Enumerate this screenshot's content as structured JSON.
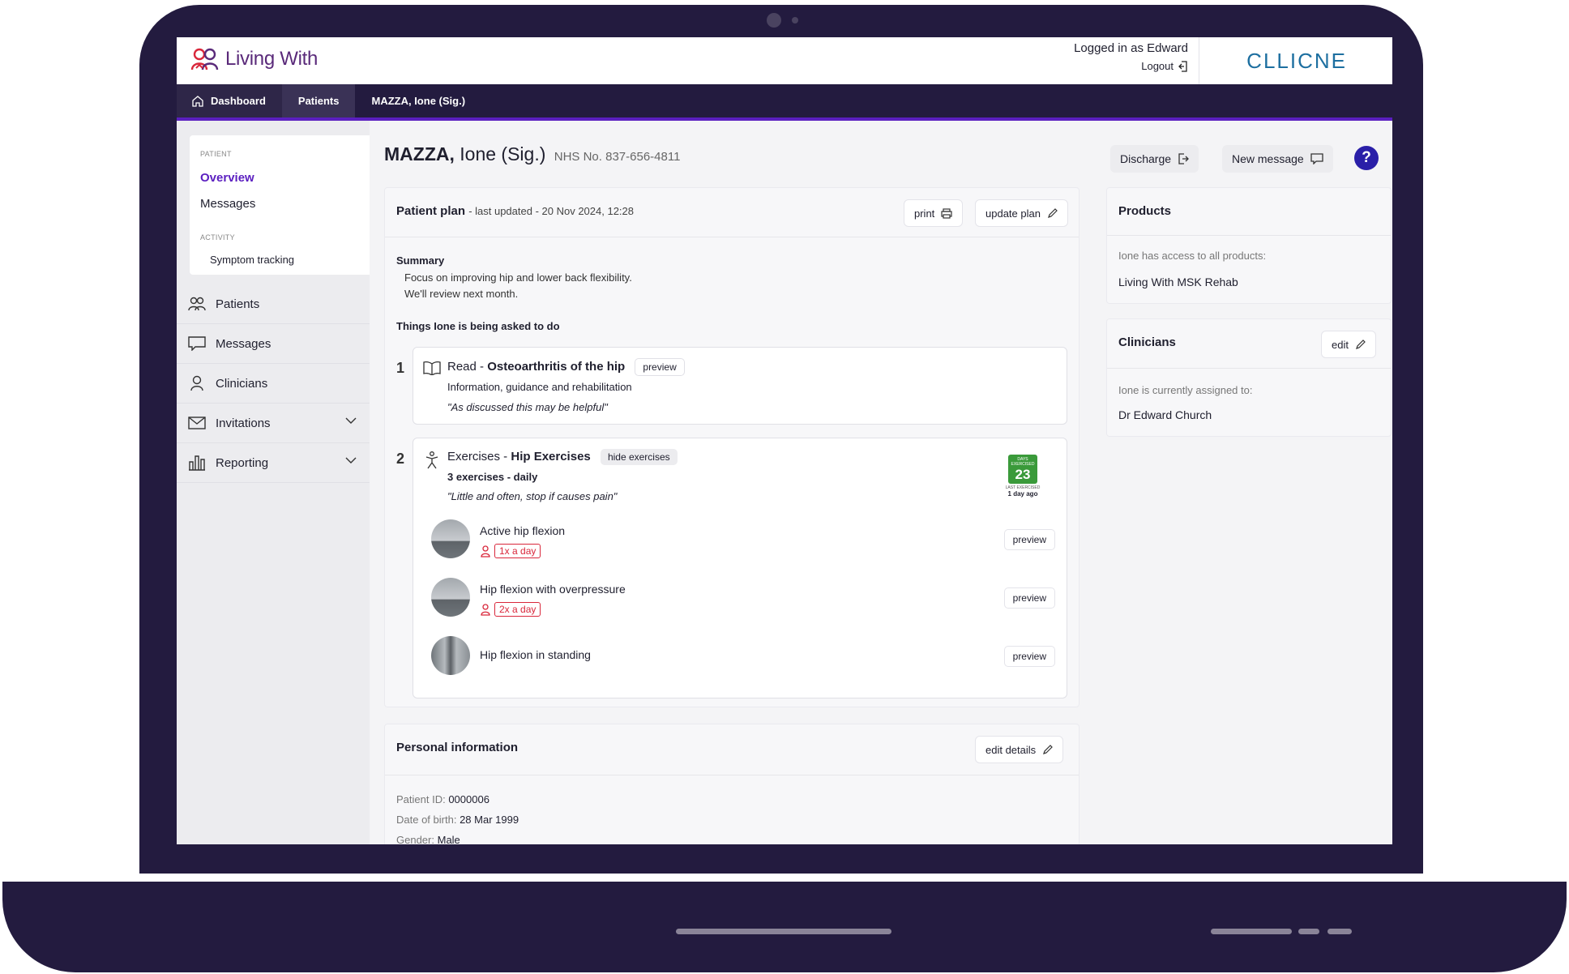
{
  "app": {
    "logo_text": "Living With",
    "brand": "CLLICNE"
  },
  "header": {
    "logged_in": "Logged in as Edward",
    "logout": "Logout"
  },
  "breadcrumb": {
    "home": "Dashboard",
    "patients": "Patients",
    "current": "MAZZA, Ione (Sig.)"
  },
  "sidebar": {
    "patient_label": "PATIENT",
    "overview": "Overview",
    "messages": "Messages",
    "activity_label": "ACTIVITY",
    "symptom_tracking": "Symptom tracking",
    "nav": [
      {
        "label": "Patients"
      },
      {
        "label": "Messages"
      },
      {
        "label": "Clinicians"
      },
      {
        "label": "Invitations"
      },
      {
        "label": "Reporting"
      }
    ]
  },
  "patient": {
    "surname": "MAZZA,",
    "given": "Ione (Sig.)",
    "nhs": "NHS No. 837-656-4811"
  },
  "actions": {
    "discharge": "Discharge",
    "new_message": "New message",
    "help": "?"
  },
  "plan": {
    "title": "Patient plan",
    "updated": "- last updated - 20 Nov 2024, 12:28",
    "print": "print",
    "update": "update plan",
    "summary_title": "Summary",
    "summary_line1": "Focus on improving hip and lower back flexibility.",
    "summary_line2": "We'll review next month.",
    "tasks_title": "Things Ione is being asked to do",
    "task1": {
      "num": "1",
      "prefix": "Read - ",
      "name": "Osteoarthritis of the hip",
      "tag": "preview",
      "desc": "Information, guidance and rehabilitation",
      "note": "\"As discussed this may be helpful\""
    },
    "task2": {
      "num": "2",
      "prefix": "Exercises - ",
      "name": "Hip Exercises",
      "tag": "hide exercises",
      "freq": "3 exercises - daily",
      "note": "\"Little and often, stop if causes pain\"",
      "calendar_top": "DAYS EXERCISED",
      "calendar_day": "23",
      "calendar_bottom": "LAST EXERCISED",
      "calendar_ago": "1 day ago",
      "exercises": [
        {
          "name": "Active hip flexion",
          "freq": "1x a day",
          "preview": "preview"
        },
        {
          "name": "Hip flexion with overpressure",
          "freq": "2x a day",
          "preview": "preview"
        },
        {
          "name": "Hip flexion in standing",
          "preview": "preview"
        }
      ]
    }
  },
  "personal": {
    "title": "Personal information",
    "edit": "edit details",
    "id_label": "Patient ID:",
    "id_value": "0000006",
    "dob_label": "Date of birth:",
    "dob_value": "28 Mar 1999",
    "gender_label": "Gender:",
    "gender_value": "Male"
  },
  "products": {
    "title": "Products",
    "label": "Ione has access to all products:",
    "item": "Living With MSK Rehab"
  },
  "clinicians": {
    "title": "Clinicians",
    "edit": "edit",
    "label": "Ione is currently assigned to:",
    "item": "Dr Edward Church"
  },
  "colors": {
    "frame": "#231b3f",
    "accent": "#5b1fc0",
    "alert": "#d9273b",
    "calendar": "#3a9a3a"
  }
}
